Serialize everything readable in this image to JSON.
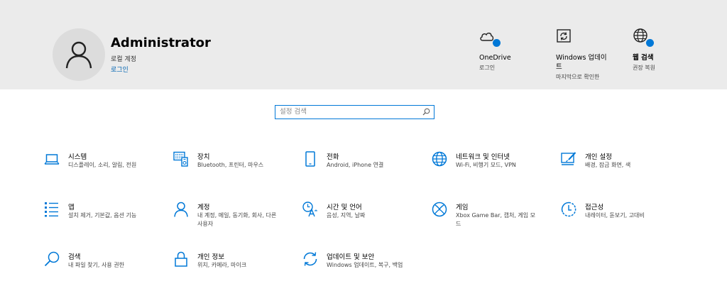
{
  "header": {
    "user": {
      "name": "Administrator",
      "account_type": "로컬 계정",
      "login_link": "로그인",
      "avatar_icon": "person-icon"
    },
    "items": [
      {
        "title": "OneDrive",
        "subtitle": "로그인",
        "icon": "cloud-icon"
      },
      {
        "title": "Windows 업데이트",
        "subtitle": "마지막으로 확인한",
        "icon": "update-icon"
      },
      {
        "title": "웹 검색",
        "subtitle": "권장 복원",
        "icon": "globe-icon"
      }
    ]
  },
  "search": {
    "placeholder": "설정 검색",
    "value": ""
  },
  "categories": [
    {
      "title": "시스템",
      "subtitle": "디스플레이, 소리, 알림, 전원",
      "icon": "laptop-icon"
    },
    {
      "title": "장치",
      "subtitle": "Bluetooth, 프린터, 마우스",
      "icon": "devices-icon"
    },
    {
      "title": "전화",
      "subtitle": "Android, iPhone 연결",
      "icon": "phone-icon"
    },
    {
      "title": "네트워크 및 인터넷",
      "subtitle": "Wi-Fi, 비행기 모드, VPN",
      "icon": "globe-icon"
    },
    {
      "title": "개인 설정",
      "subtitle": "배경, 잠금 화면, 색",
      "icon": "personalization-icon"
    },
    {
      "title": "앱",
      "subtitle": "설치 제거, 기본값, 옵션 기능",
      "icon": "apps-list-icon"
    },
    {
      "title": "계정",
      "subtitle": "내 계정, 메일, 동기화, 회사, 다른 사용자",
      "icon": "person-icon"
    },
    {
      "title": "시간 및 언어",
      "subtitle": "음성, 지역, 날짜",
      "icon": "time-language-icon"
    },
    {
      "title": "게임",
      "subtitle": "Xbox Game Bar, 캡처, 게임 모드",
      "icon": "xbox-icon"
    },
    {
      "title": "접근성",
      "subtitle": "내레이터, 돋보기, 고대비",
      "icon": "accessibility-icon"
    },
    {
      "title": "검색",
      "subtitle": "내 파일 찾기, 사용 권한",
      "icon": "search-icon"
    },
    {
      "title": "개인 정보",
      "subtitle": "위치, 카메라, 마이크",
      "icon": "lock-icon"
    },
    {
      "title": "업데이트 및 보안",
      "subtitle": "Windows 업데이트, 복구, 백업",
      "icon": "sync-icon"
    }
  ],
  "colors": {
    "accent": "#0078d7",
    "header_bg": "#ebebeb",
    "link": "#0063b1"
  }
}
